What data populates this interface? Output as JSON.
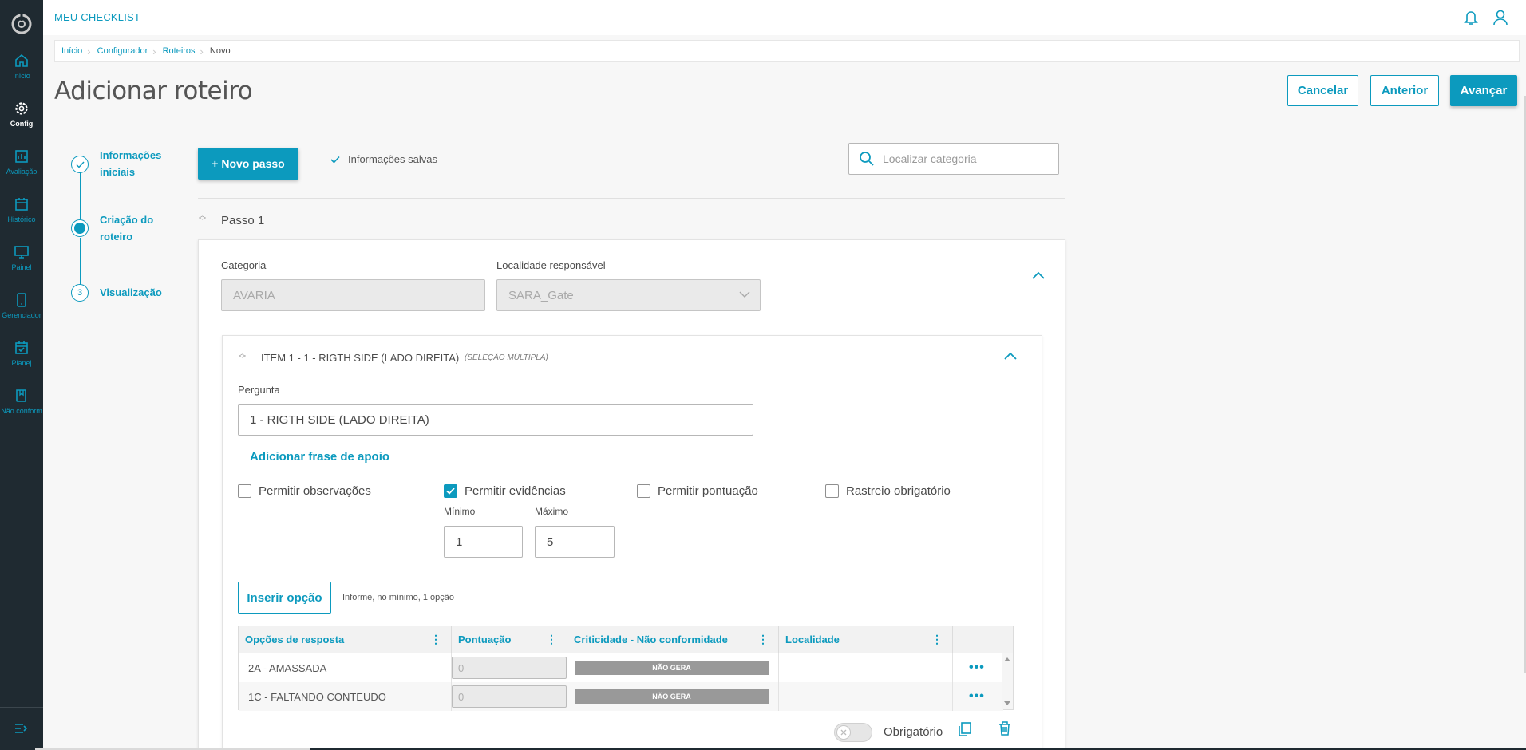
{
  "app": {
    "title": "MEU CHECKLIST"
  },
  "sidebar": {
    "items": [
      {
        "label": "Início",
        "icon": "home-icon"
      },
      {
        "label": "Config",
        "icon": "gear-icon",
        "active": true
      },
      {
        "label": "Avaliação",
        "icon": "report-icon"
      },
      {
        "label": "Histórico",
        "icon": "calendar-icon"
      },
      {
        "label": "Painel",
        "icon": "monitor-icon"
      },
      {
        "label": "Gerenciador",
        "icon": "tablet-icon"
      },
      {
        "label": "Planej",
        "icon": "calendar-check-icon"
      },
      {
        "label": "Não conform",
        "icon": "book-icon"
      }
    ]
  },
  "breadcrumb": [
    "Início",
    "Configurador",
    "Roteiros",
    "Novo"
  ],
  "page": {
    "title": "Adicionar roteiro"
  },
  "actions": {
    "cancel": "Cancelar",
    "previous": "Anterior",
    "next": "Avançar"
  },
  "stepper": {
    "steps": [
      {
        "label": "Informações iniciais",
        "state": "done"
      },
      {
        "label": "Criação do roteiro",
        "state": "active"
      },
      {
        "label": "Visualização",
        "state": "pending",
        "number": "3"
      }
    ]
  },
  "toolbar": {
    "new_step": "+  Novo passo",
    "saved_status": "Informações salvas",
    "search_placeholder": "Localizar categoria"
  },
  "step": {
    "title": "Passo 1",
    "category_label": "Categoria",
    "category_value": "AVARIA",
    "location_label": "Localidade responsável",
    "location_value": "SARA_Gate"
  },
  "item": {
    "title": "ITEM 1 - 1 - RIGTH SIDE (LADO DIREITA)",
    "type": "(SELEÇÃO MÚLTIPLA)",
    "question_label": "Pergunta",
    "question_value": "1 - RIGTH SIDE (LADO DIREITA)",
    "add_support_phrase": "Adicionar frase de apoio",
    "options": {
      "allow_observations": {
        "label": "Permitir observações",
        "checked": false
      },
      "allow_evidence": {
        "label": "Permitir evidências",
        "checked": true
      },
      "allow_scoring": {
        "label": "Permitir pontuação",
        "checked": false
      },
      "mandatory_tracking": {
        "label": "Rastreio obrigatório",
        "checked": false
      }
    },
    "min_label": "Mínimo",
    "min_value": "1",
    "max_label": "Máximo",
    "max_value": "5",
    "insert_option": "Inserir opção",
    "insert_hint": "Informe, no mínimo, 1 opção",
    "table": {
      "headers": [
        "Opções de resposta",
        "Pontuação",
        "Criticidade - Não conformidade",
        "Localidade"
      ],
      "rows": [
        {
          "option": "2A - AMASSADA",
          "score": "0",
          "criticality": "NÃO GERA",
          "location": ""
        },
        {
          "option": "1C - FALTANDO CONTEUDO",
          "score": "0",
          "criticality": "NÃO GERA",
          "location": ""
        }
      ]
    },
    "required_label": "Obrigatório",
    "required": false
  },
  "colors": {
    "accent": "#0c9abe",
    "sidebar": "#1f2a31",
    "badge": "#999999"
  }
}
